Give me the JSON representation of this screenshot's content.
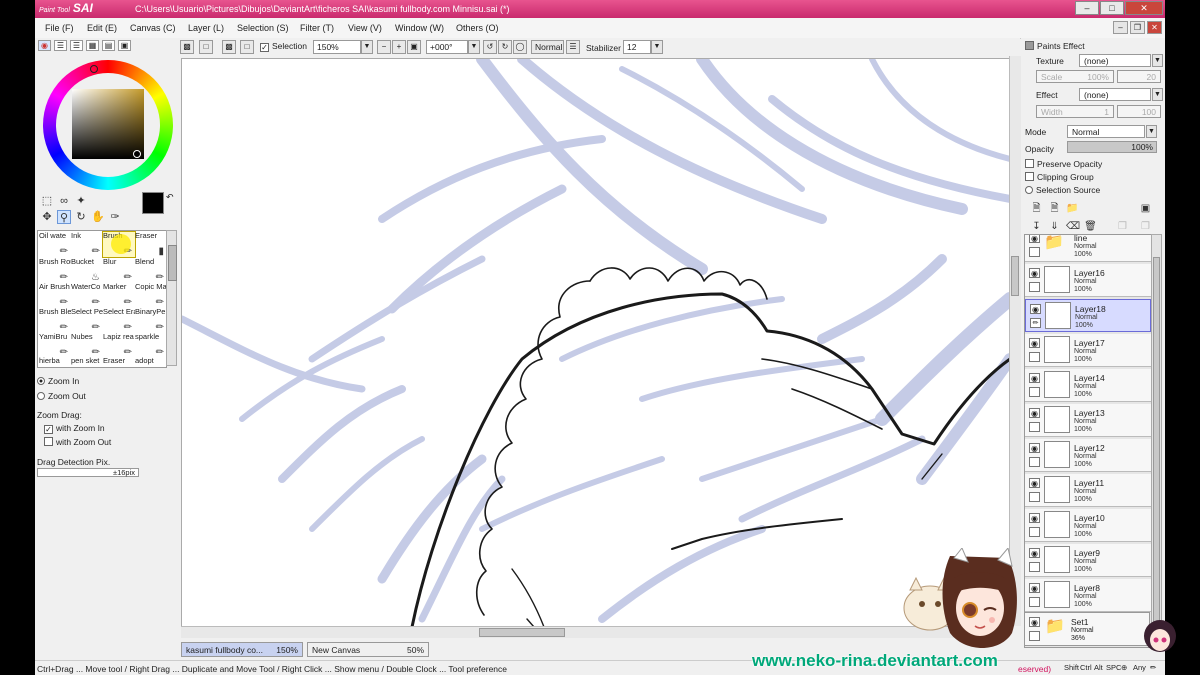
{
  "window": {
    "logo_small": "Paint Tool",
    "logo": "SAI",
    "path": "C:\\Users\\Usuario\\Pictures\\Dibujos\\DeviantArt\\ficheros SAI\\kasumi fullbody.com Minnisu.sai (*)"
  },
  "menu": [
    "File (F)",
    "Edit (E)",
    "Canvas (C)",
    "Layer (L)",
    "Selection (S)",
    "Filter (T)",
    "View (V)",
    "Window (W)",
    "Others (O)"
  ],
  "toolbar": {
    "selection_label": "Selection",
    "zoom": "150%",
    "rotation": "+000°",
    "mode": "Normal",
    "stabilizer_label": "Stabilizer",
    "stabilizer": "12"
  },
  "brushes": [
    [
      "Oil wate",
      "Ink",
      "Brush",
      "Eraser"
    ],
    [
      "Brush Round",
      "Bucket",
      "Blur",
      "Blend"
    ],
    [
      "Air Brush",
      "WaterCo",
      "Marker",
      "Copic Marke"
    ],
    [
      "Brush Blend",
      "Select Pen",
      "Select Erase",
      "BinaryPe"
    ],
    [
      "YamiBru",
      "Nubes",
      "Lapiz rea",
      "sparkle"
    ],
    [
      "hierba",
      "pen sket",
      "Eraser",
      "adopt"
    ]
  ],
  "zoom_options": {
    "zoom_in": "Zoom In",
    "zoom_out": "Zoom Out",
    "drag_label": "Zoom Drag:",
    "with_zoom_in": "with Zoom In",
    "with_zoom_out": "with Zoom Out",
    "detection_label": "Drag Detection Pix.",
    "detection_value": "±16pix"
  },
  "paints_effect": {
    "title": "Paints Effect",
    "texture_label": "Texture",
    "texture_value": "(none)",
    "scale_label": "Scale",
    "scale_value": "100%",
    "scale_num": "20",
    "effect_label": "Effect",
    "effect_value": "(none)",
    "width_label": "Width",
    "width_value": "1",
    "width_num": "100"
  },
  "layer_props": {
    "mode_label": "Mode",
    "mode_value": "Normal",
    "opacity_label": "Opacity",
    "opacity_value": "100%",
    "preserve_opacity": "Preserve Opacity",
    "clipping_group": "Clipping Group",
    "selection_source": "Selection Source"
  },
  "layers": [
    {
      "name": "line",
      "mode": "Normal",
      "opacity": "100%",
      "type": "folder"
    },
    {
      "name": "Layer16",
      "mode": "Normal",
      "opacity": "100%",
      "type": "layer"
    },
    {
      "name": "Layer18",
      "mode": "Normal",
      "opacity": "100%",
      "type": "layer",
      "selected": true
    },
    {
      "name": "Layer17",
      "mode": "Normal",
      "opacity": "100%",
      "type": "layer"
    },
    {
      "name": "Layer14",
      "mode": "Normal",
      "opacity": "100%",
      "type": "layer"
    },
    {
      "name": "Layer13",
      "mode": "Normal",
      "opacity": "100%",
      "type": "layer"
    },
    {
      "name": "Layer12",
      "mode": "Normal",
      "opacity": "100%",
      "type": "layer"
    },
    {
      "name": "Layer11",
      "mode": "Normal",
      "opacity": "100%",
      "type": "layer"
    },
    {
      "name": "Layer10",
      "mode": "Normal",
      "opacity": "100%",
      "type": "layer"
    },
    {
      "name": "Layer9",
      "mode": "Normal",
      "opacity": "100%",
      "type": "layer"
    },
    {
      "name": "Layer8",
      "mode": "Normal",
      "opacity": "100%",
      "type": "layer"
    }
  ],
  "set_layer": {
    "name": "Set1",
    "mode": "Normal",
    "opacity": "36%"
  },
  "doc_tabs": [
    {
      "name": "kasumi fullbody co...",
      "zoom": "150%"
    },
    {
      "name": "New Canvas",
      "zoom": "50%"
    }
  ],
  "status": {
    "text": "Ctrl+Drag ... Move tool / Right Drag ... Duplicate and Move Tool / Right Click ... Show menu / Double Clock ... Tool preference",
    "keys": [
      "Shift",
      "Ctrl",
      "Alt",
      "SPC",
      "Any"
    ],
    "reserved": "eserved)"
  },
  "watermark": "www.neko-rina.deviantart.com",
  "colors": {
    "accent": "#d2145f",
    "title": "#e0397f",
    "sketch": "#c5cbe6",
    "watermark": "#00a87a"
  }
}
